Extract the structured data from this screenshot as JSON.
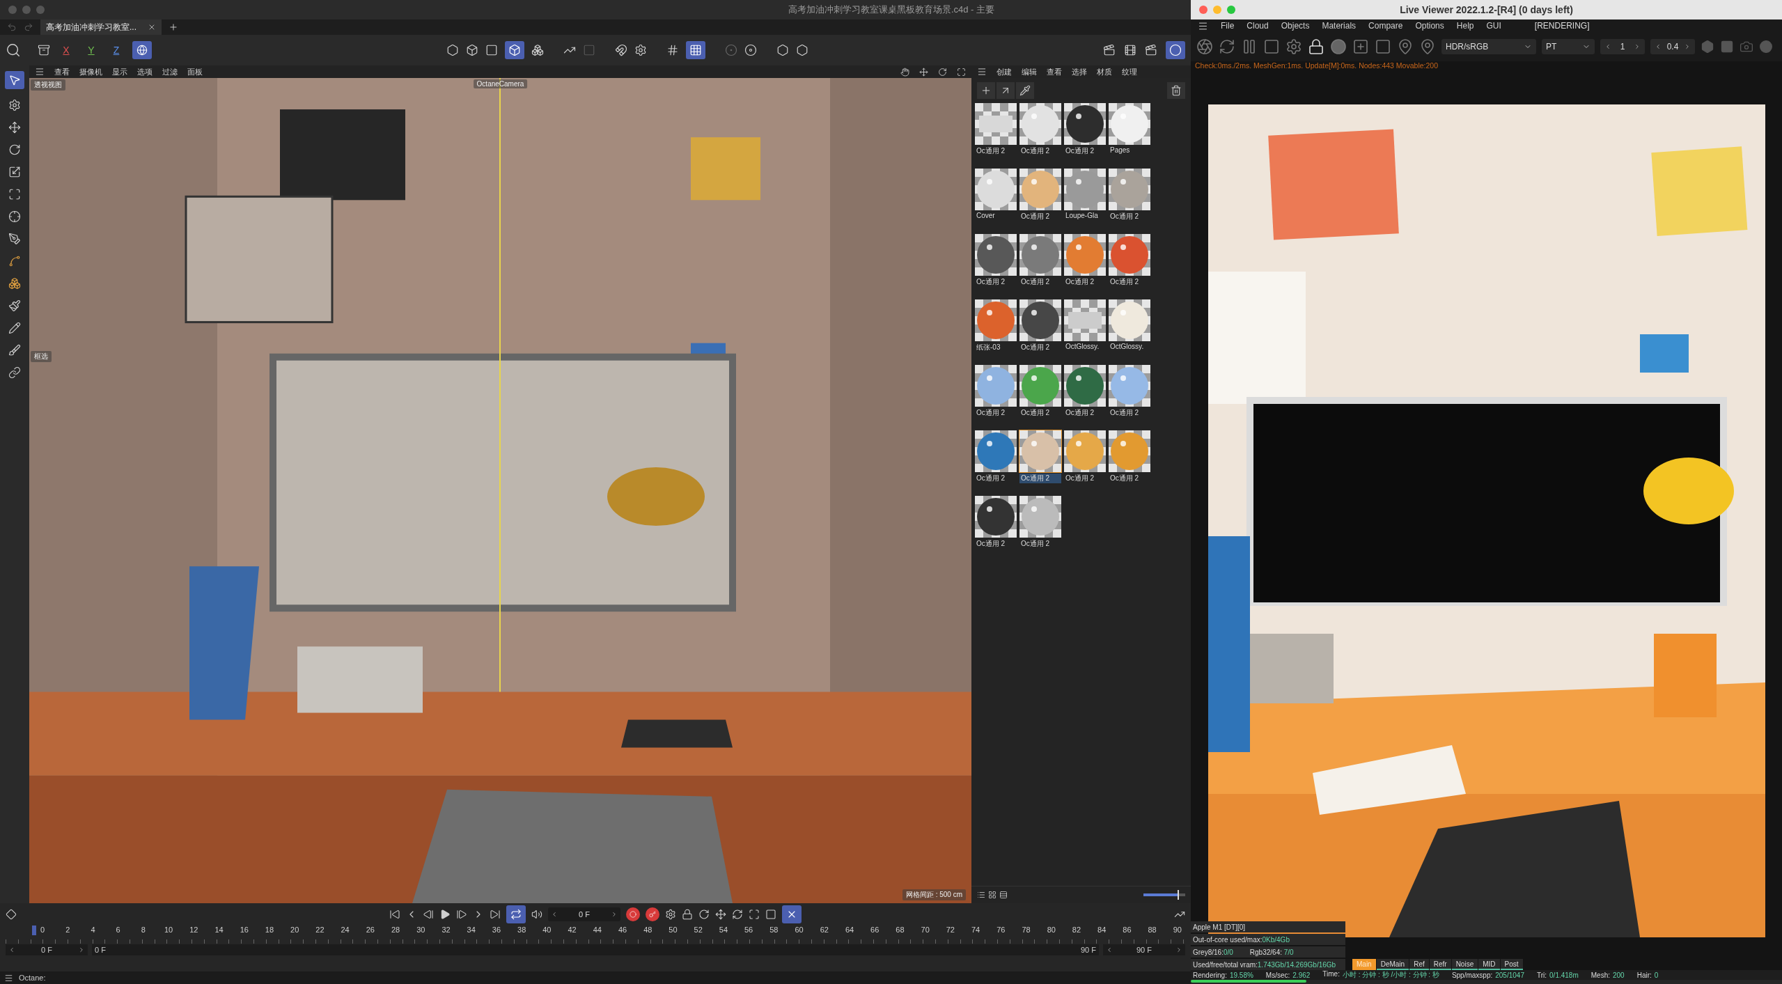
{
  "main_window": {
    "title": "高考加油冲刺学习教室课桌黑板教育场景.c4d - 主要",
    "tabs": [
      {
        "label": "高考加油冲刺学习教室...",
        "selected": true
      }
    ],
    "axis_buttons": [
      {
        "label": "X",
        "selected": false
      },
      {
        "label": "Y",
        "selected": false
      },
      {
        "label": "Z",
        "selected": false
      }
    ],
    "viewport_menu": [
      "查看",
      "摄像机",
      "显示",
      "选项",
      "过滤",
      "面板"
    ],
    "viewport": {
      "view_label": "透视视图",
      "camera_label": "OctaneCamera",
      "side_label": "框选",
      "grid_spacing": "网格间距 : 500 cm"
    },
    "material_menu": [
      "创建",
      "编辑",
      "查看",
      "选择",
      "材质",
      "纹理"
    ],
    "materials": [
      {
        "name": "Oc通用 2",
        "kind": "flat",
        "color": "#d8d8d8",
        "selected": false
      },
      {
        "name": "Oc通用 2",
        "kind": "sphere",
        "color": "#e2e2e2",
        "selected": false
      },
      {
        "name": "Oc通用 2",
        "kind": "sphere",
        "color": "#2d2d2d",
        "selected": false
      },
      {
        "name": "Pages",
        "kind": "sphere",
        "color": "#f0f0f0",
        "selected": false
      },
      {
        "name": "Cover",
        "kind": "sphere",
        "color": "#dcdcdc",
        "selected": false
      },
      {
        "name": "Oc通用 2",
        "kind": "sphere",
        "color": "#e2b47c",
        "selected": false
      },
      {
        "name": "Loupe-Gla",
        "kind": "sphere",
        "color": "#9a9a9a",
        "selected": false
      },
      {
        "name": "Oc通用 2",
        "kind": "sphere",
        "color": "#aaa39b",
        "selected": false
      },
      {
        "name": "Oc通用 2",
        "kind": "sphere",
        "color": "#585858",
        "selected": false
      },
      {
        "name": "Oc通用 2",
        "kind": "sphere",
        "color": "#7a7a7a",
        "selected": false
      },
      {
        "name": "Oc通用 2",
        "kind": "sphere",
        "color": "#e27c32",
        "selected": false
      },
      {
        "name": "Oc通用 2",
        "kind": "sphere",
        "color": "#da5230",
        "selected": false
      },
      {
        "name": "纸张-03",
        "kind": "sphere",
        "color": "#dc622c",
        "selected": false
      },
      {
        "name": "Oc通用 2",
        "kind": "sphere",
        "color": "#474747",
        "selected": false
      },
      {
        "name": "OctGlossy.",
        "kind": "flat",
        "color": "#cccccc",
        "selected": false
      },
      {
        "name": "OctGlossy.",
        "kind": "sphere",
        "color": "#efe9dd",
        "selected": false
      },
      {
        "name": "Oc通用 2",
        "kind": "sphere",
        "color": "#8fb3e0",
        "selected": false
      },
      {
        "name": "Oc通用 2",
        "kind": "sphere",
        "color": "#4ba64b",
        "selected": false
      },
      {
        "name": "Oc通用 2",
        "kind": "sphere",
        "color": "#2f6b45",
        "selected": false
      },
      {
        "name": "Oc通用 2",
        "kind": "sphere",
        "color": "#96b9e6",
        "selected": false
      },
      {
        "name": "Oc通用 2",
        "kind": "sphere",
        "color": "#2e78b8",
        "selected": false
      },
      {
        "name": "Oc通用 2",
        "kind": "sphere",
        "color": "#d8c0a8",
        "selected": true
      },
      {
        "name": "Oc通用 2",
        "kind": "sphere",
        "color": "#e5a848",
        "selected": false
      },
      {
        "name": "Oc通用 2",
        "kind": "sphere",
        "color": "#e29a30",
        "selected": false
      },
      {
        "name": "Oc通用 2",
        "kind": "sphere",
        "color": "#333333",
        "selected": false
      },
      {
        "name": "Oc通用 2",
        "kind": "sphere",
        "color": "#bbbbbb",
        "selected": false
      }
    ],
    "material_zoom": {
      "level": 0.85
    },
    "timeline": {
      "current_frame": "0 F",
      "ruler": [
        "0",
        "2",
        "4",
        "6",
        "8",
        "10",
        "12",
        "14",
        "16",
        "18",
        "20",
        "22",
        "24",
        "26",
        "28",
        "30",
        "32",
        "34",
        "36",
        "38",
        "40",
        "42",
        "44",
        "46",
        "48",
        "50",
        "52",
        "54",
        "56",
        "58",
        "60",
        "62",
        "64",
        "66",
        "68",
        "70",
        "72",
        "74",
        "76",
        "78",
        "80",
        "82",
        "84",
        "86",
        "88",
        "90"
      ],
      "range_start": "0 F",
      "preview_start": "0 F",
      "preview_end": "90 F",
      "range_end": "90 F"
    },
    "status": "Octane:"
  },
  "live_viewer": {
    "title": "Live Viewer 2022.1.2-[R4] (0 days left)",
    "menu": [
      "File",
      "Cloud",
      "Objects",
      "Materials",
      "Compare",
      "Options",
      "Help",
      "GUI"
    ],
    "state": "[RENDERING]",
    "display_mode": "HDR/sRGB",
    "kernel": "PT",
    "steppers": [
      "1",
      "0.4"
    ],
    "stats": "Check:0ms./2ms. MeshGen:1ms. Update[M]:0ms. Nodes:443 Movable:200",
    "device": "Apple M1 [DT][0]",
    "device_info": [
      {
        "label": "Out-of-core used/max:",
        "value": "0Kb/4Gb"
      },
      {
        "label": "Grey8/16:",
        "value": "0/0",
        "label_2": "Rgb32/64:",
        "value_2": "7/0"
      },
      {
        "label": "Used/free/total vram:",
        "value": "1.743Gb/14.269Gb/16Gb"
      }
    ],
    "passes": [
      {
        "label": "Main",
        "selected": true
      },
      {
        "label": "DeMain",
        "selected": false
      },
      {
        "label": "Ref",
        "selected": false
      },
      {
        "label": "Refr",
        "selected": false
      },
      {
        "label": "Noise",
        "selected": false
      },
      {
        "label": "MID",
        "selected": false
      },
      {
        "label": "Post",
        "selected": false
      }
    ],
    "status_items": [
      {
        "label": "Rendering:",
        "value": "19.58%"
      },
      {
        "label": "Ms/sec:",
        "value": "2.962"
      },
      {
        "label": "Time:",
        "value": "小时 : 分钟 : 秒 /小时 : 分钟 : 秒"
      },
      {
        "label": "Spp/maxspp:",
        "value": "205/1047"
      },
      {
        "label": "Tri:",
        "value": "0/1.418m"
      },
      {
        "label": "Mesh:",
        "value": "200"
      },
      {
        "label": "Hair:",
        "value": "0"
      }
    ],
    "progress": {
      "level": 0.196
    }
  }
}
